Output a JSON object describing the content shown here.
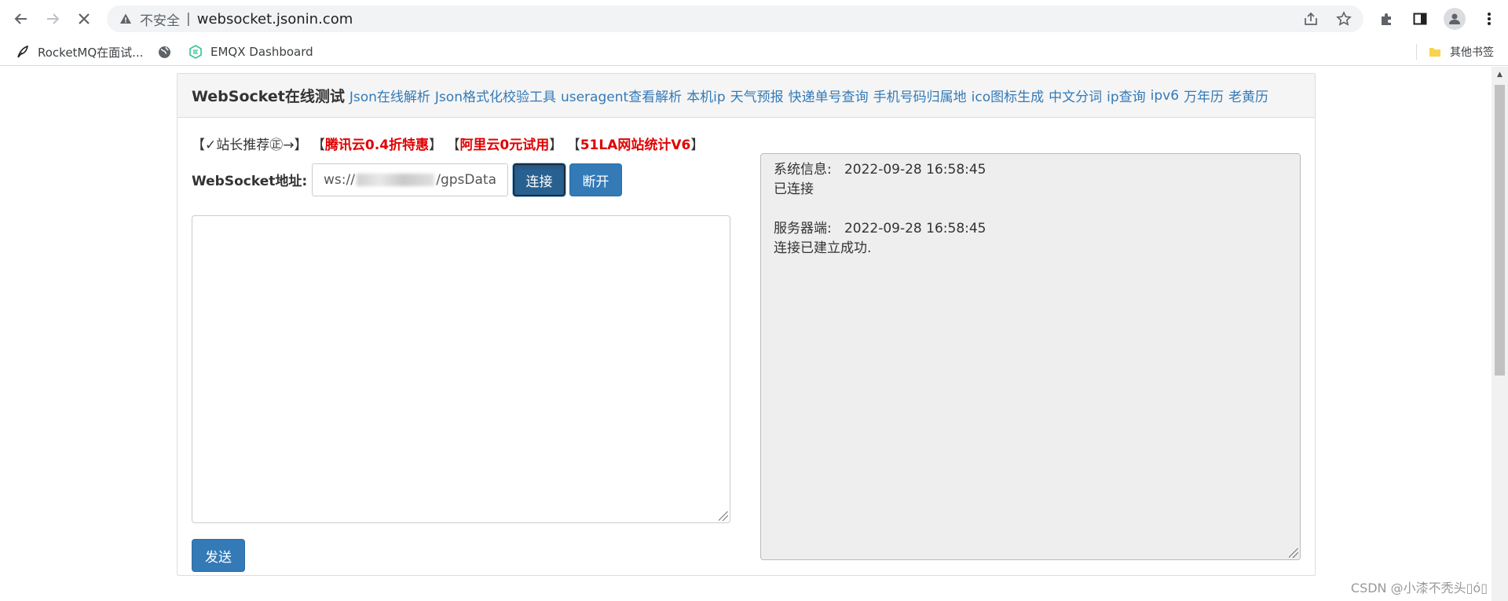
{
  "browser": {
    "security_label": "不安全",
    "separator": "|",
    "url": "websocket.jsonin.com",
    "icons": {
      "back": "arrow-left-icon",
      "forward": "arrow-right-icon",
      "stop": "close-icon",
      "warning": "warning-icon",
      "share": "share-icon",
      "bookmark_star": "star-icon",
      "extensions": "puzzle-icon",
      "side_panel": "side-panel-icon",
      "profile": "person-icon",
      "menu": "more-vertical-icon"
    }
  },
  "bookmarks": {
    "items": [
      {
        "label": "RocketMQ在面试...",
        "icon": "feather-icon"
      },
      {
        "label": "",
        "icon": "globe-icon"
      },
      {
        "label": "EMQX Dashboard",
        "icon": "emqx-icon"
      }
    ],
    "other_label": "其他书签"
  },
  "header": {
    "title": "WebSocket在线测试",
    "links": [
      "Json在线解析",
      "Json格式化校验工具",
      "useragent查看解析",
      "本机ip",
      "天气预报",
      "快递单号查询",
      "手机号码归属地",
      "ico图标生成",
      "中文分词",
      "ip查询",
      "ipv6",
      "万年历",
      "老黄历"
    ]
  },
  "recommend": {
    "intro": "【✓站长推荐㊣→】",
    "promos": [
      {
        "open": "【",
        "text": "腾讯云0.4折特惠",
        "close": "】"
      },
      {
        "open": "【",
        "text": "阿里云0元试用",
        "close": "】"
      },
      {
        "open": "【",
        "text": "51LA网站统计V6",
        "close": "】"
      }
    ]
  },
  "form": {
    "address_label": "WebSocket地址:",
    "address_prefix": "ws://",
    "address_suffix": "/gpsData",
    "connect_label": "连接",
    "disconnect_label": "断开",
    "send_label": "发送",
    "message_value": ""
  },
  "log": {
    "lines": [
      "系统信息:   2022-09-28 16:58:45",
      "已连接",
      "",
      "服务器端:   2022-09-28 16:58:45",
      "连接已建立成功."
    ]
  },
  "watermark": "CSDN @小漆不秃头▯ó▯",
  "colors": {
    "link": "#337ab7",
    "primary_button": "#337ab7",
    "promo": "#e00000",
    "log_background": "#eeeeee"
  }
}
